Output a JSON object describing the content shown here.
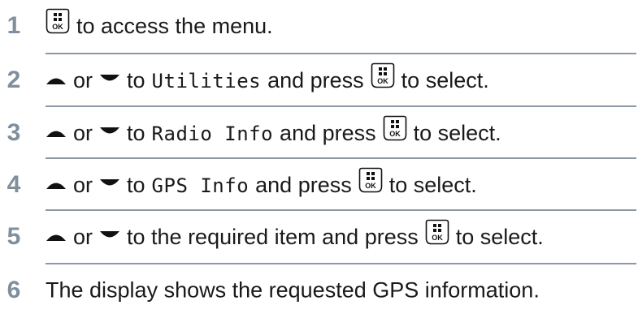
{
  "steps": [
    {
      "num": "1",
      "parts": [
        {
          "type": "icon",
          "icon": "menu-ok-button-icon"
        },
        {
          "type": "text",
          "text": "to access the menu."
        }
      ]
    },
    {
      "num": "2",
      "parts": [
        {
          "type": "icon",
          "icon": "up-arrow-icon"
        },
        {
          "type": "text",
          "text": "or"
        },
        {
          "type": "icon",
          "icon": "down-arrow-icon"
        },
        {
          "type": "text",
          "text": "to"
        },
        {
          "type": "mono",
          "text": "Utilities"
        },
        {
          "type": "text",
          "text": "and press"
        },
        {
          "type": "icon",
          "icon": "menu-ok-button-icon"
        },
        {
          "type": "text",
          "text": "to select."
        }
      ]
    },
    {
      "num": "3",
      "parts": [
        {
          "type": "icon",
          "icon": "up-arrow-icon"
        },
        {
          "type": "text",
          "text": "or"
        },
        {
          "type": "icon",
          "icon": "down-arrow-icon"
        },
        {
          "type": "text",
          "text": "to"
        },
        {
          "type": "mono",
          "text": "Radio Info"
        },
        {
          "type": "text",
          "text": "and press"
        },
        {
          "type": "icon",
          "icon": "menu-ok-button-icon"
        },
        {
          "type": "text",
          "text": "to select."
        }
      ]
    },
    {
      "num": "4",
      "parts": [
        {
          "type": "icon",
          "icon": "up-arrow-icon"
        },
        {
          "type": "text",
          "text": "or"
        },
        {
          "type": "icon",
          "icon": "down-arrow-icon"
        },
        {
          "type": "text",
          "text": "to"
        },
        {
          "type": "mono",
          "text": "GPS Info"
        },
        {
          "type": "text",
          "text": "and press"
        },
        {
          "type": "icon",
          "icon": "menu-ok-button-icon"
        },
        {
          "type": "text",
          "text": "to select."
        }
      ]
    },
    {
      "num": "5",
      "parts": [
        {
          "type": "icon",
          "icon": "up-arrow-icon"
        },
        {
          "type": "text",
          "text": "or"
        },
        {
          "type": "icon",
          "icon": "down-arrow-icon"
        },
        {
          "type": "text",
          "text": "to the required item and press"
        },
        {
          "type": "icon",
          "icon": "menu-ok-button-icon"
        },
        {
          "type": "text",
          "text": "to select."
        }
      ]
    },
    {
      "num": "6",
      "parts": [
        {
          "type": "text",
          "text": "The display shows the requested GPS information."
        }
      ]
    }
  ],
  "ok_button_label": "OK",
  "colors": {
    "step_number": "#7f8f9d",
    "divider": "#8c98a4",
    "text": "#1a1a1a"
  }
}
